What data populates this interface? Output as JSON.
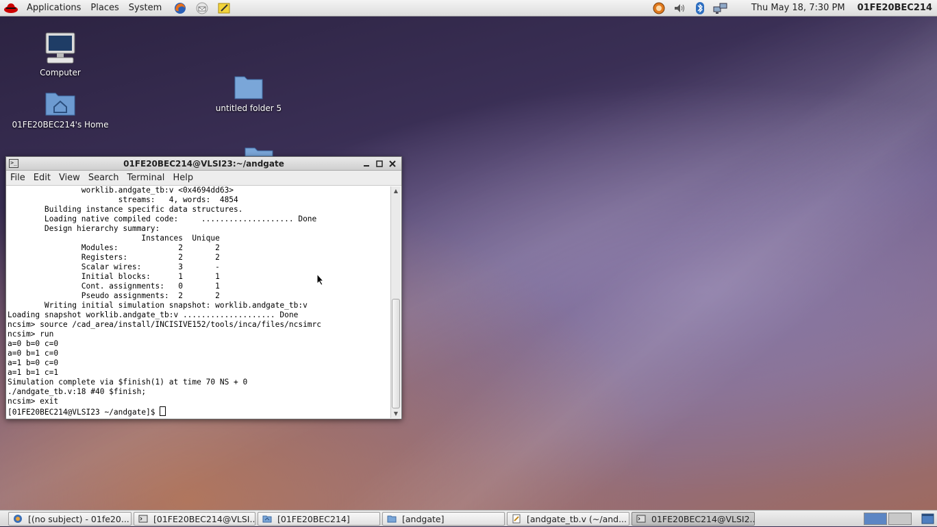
{
  "top_panel": {
    "menus": [
      "Applications",
      "Places",
      "System"
    ],
    "clock": "Thu May 18,  7:30 PM",
    "user": "01FE20BEC214"
  },
  "desktop": {
    "icons": [
      {
        "label": "Computer"
      },
      {
        "label": "01FE20BEC214's Home"
      },
      {
        "label": "untitled folder 5"
      }
    ]
  },
  "terminal": {
    "title": "01FE20BEC214@VLSI23:~/andgate",
    "menu": [
      "File",
      "Edit",
      "View",
      "Search",
      "Terminal",
      "Help"
    ],
    "lines": [
      "                worklib.andgate_tb:v <0x4694dd63>",
      "                        streams:   4, words:  4854",
      "        Building instance specific data structures.",
      "        Loading native compiled code:     .................... Done",
      "        Design hierarchy summary:",
      "                             Instances  Unique",
      "                Modules:             2       2",
      "                Registers:           2       2",
      "                Scalar wires:        3       -",
      "                Initial blocks:      1       1",
      "                Cont. assignments:   0       1",
      "                Pseudo assignments:  2       2",
      "        Writing initial simulation snapshot: worklib.andgate_tb:v",
      "Loading snapshot worklib.andgate_tb:v .................... Done",
      "ncsim> source /cad_area/install/INCISIVE152/tools/inca/files/ncsimrc",
      "ncsim> run",
      "a=0 b=0 c=0",
      "a=0 b=1 c=0",
      "a=1 b=0 c=0",
      "a=1 b=1 c=1",
      "Simulation complete via $finish(1) at time 70 NS + 0",
      "./andgate_tb.v:18 #40 $finish;",
      "ncsim> exit"
    ],
    "prompt": "[01FE20BEC214@VLSI23 ~/andgate]$ "
  },
  "taskbar": {
    "tasks": [
      {
        "label": "[(no subject) - 01fe20...",
        "icon": "thunderbird-icon"
      },
      {
        "label": "[01FE20BEC214@VLSI...",
        "icon": "terminal-icon"
      },
      {
        "label": "[01FE20BEC214]",
        "icon": "home-folder-icon"
      },
      {
        "label": "[andgate]",
        "icon": "folder-icon"
      },
      {
        "label": "[andgate_tb.v (~/and...",
        "icon": "text-editor-icon"
      },
      {
        "label": "01FE20BEC214@VLSI2...",
        "icon": "terminal-icon",
        "active": true
      }
    ]
  },
  "colors": {
    "workspace_active": "#5c86c4"
  }
}
